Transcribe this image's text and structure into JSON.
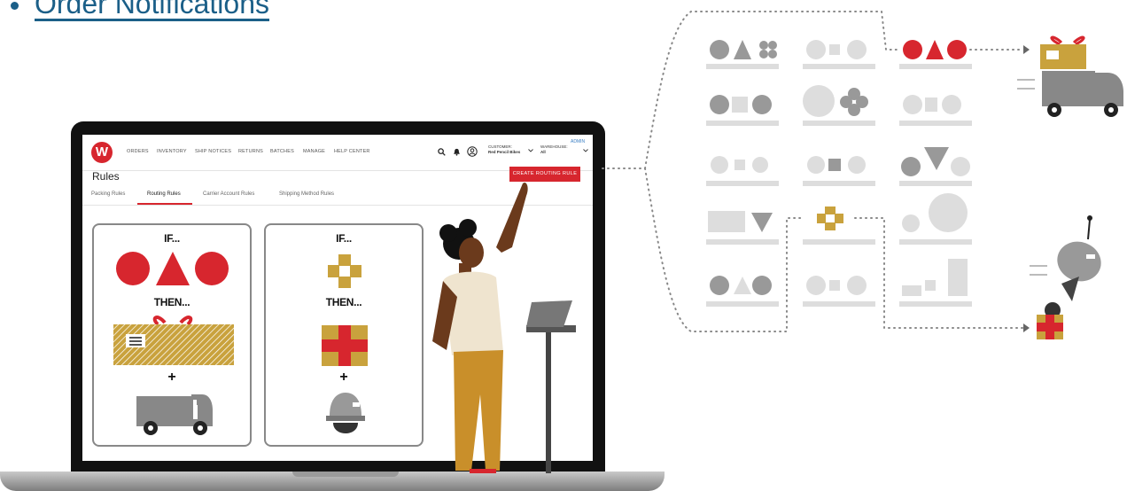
{
  "header": {
    "bullet_link": "Order Notifications"
  },
  "app": {
    "nav_items": [
      "ORDERS",
      "INVENTORY",
      "SHIP NOTICES",
      "RETURNS",
      "BATCHES",
      "MANAGE",
      "HELP CENTER"
    ],
    "customer_label": "CUSTOMER:",
    "customer_value": "Red Pencil Bikes",
    "warehouse_label": "WAREHOUSE:",
    "warehouse_value": "All",
    "admin_label": "ADMIN",
    "page_title": "Rules",
    "create_button": "CREATE ROUTING RULE",
    "tabs": [
      "Packing Rules",
      "Routing Rules",
      "Carrier Account Rules",
      "Shipping Method Rules"
    ],
    "active_tab": "Routing Rules"
  },
  "cards": [
    {
      "if_label": "IF...",
      "then_label": "THEN...",
      "plus": "+"
    },
    {
      "if_label": "IF...",
      "then_label": "THEN...",
      "plus": "+"
    }
  ],
  "colors": {
    "brand_red": "#d7262e",
    "gold": "#c9a23d",
    "grey_shape": "#999999",
    "light_grey": "#dddddd",
    "link_blue": "#1b5f88"
  },
  "icons": {
    "logo": "w-logo-icon",
    "search": "search-icon",
    "bell": "bell-icon",
    "user": "user-icon",
    "chevron": "chevron-down-icon"
  }
}
